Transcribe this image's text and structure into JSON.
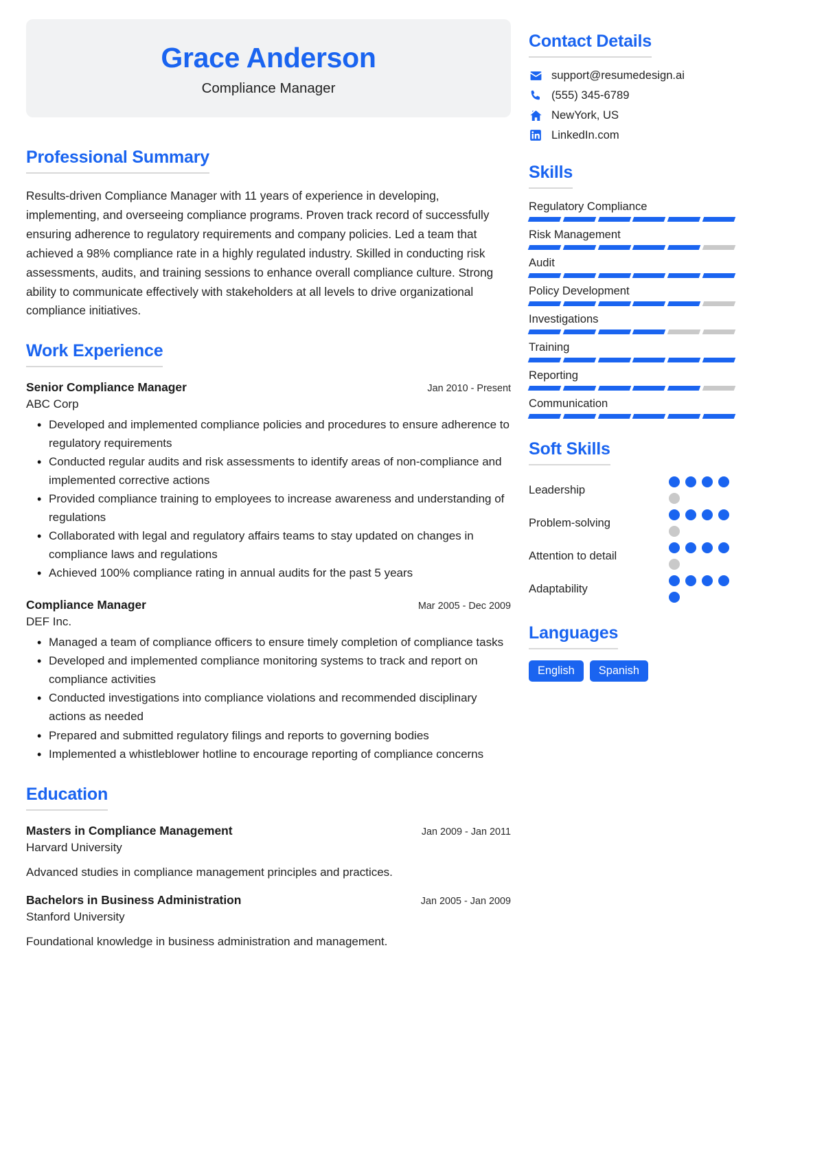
{
  "header": {
    "name": "Grace Anderson",
    "job_title": "Compliance Manager"
  },
  "summary": {
    "heading": "Professional Summary",
    "text": "Results-driven Compliance Manager with 11 years of experience in developing, implementing, and overseeing compliance programs. Proven track record of successfully ensuring adherence to regulatory requirements and company policies. Led a team that achieved a 98% compliance rate in a highly regulated industry. Skilled in conducting risk assessments, audits, and training sessions to enhance overall compliance culture. Strong ability to communicate effectively with stakeholders at all levels to drive organizational compliance initiatives."
  },
  "work_experience": {
    "heading": "Work Experience",
    "jobs": [
      {
        "title": "Senior Compliance Manager",
        "dates": "Jan 2010 - Present",
        "company": "ABC Corp",
        "bullets": [
          "Developed and implemented compliance policies and procedures to ensure adherence to regulatory requirements",
          "Conducted regular audits and risk assessments to identify areas of non-compliance and implemented corrective actions",
          "Provided compliance training to employees to increase awareness and understanding of regulations",
          "Collaborated with legal and regulatory affairs teams to stay updated on changes in compliance laws and regulations",
          "Achieved 100% compliance rating in annual audits for the past 5 years"
        ]
      },
      {
        "title": "Compliance Manager",
        "dates": "Mar 2005 - Dec 2009",
        "company": "DEF Inc.",
        "bullets": [
          "Managed a team of compliance officers to ensure timely completion of compliance tasks",
          "Developed and implemented compliance monitoring systems to track and report on compliance activities",
          "Conducted investigations into compliance violations and recommended disciplinary actions as needed",
          "Prepared and submitted regulatory filings and reports to governing bodies",
          "Implemented a whistleblower hotline to encourage reporting of compliance concerns"
        ]
      }
    ]
  },
  "education": {
    "heading": "Education",
    "entries": [
      {
        "degree": "Masters in Compliance Management",
        "dates": "Jan 2009 - Jan 2011",
        "school": "Harvard University",
        "description": "Advanced studies in compliance management principles and practices."
      },
      {
        "degree": "Bachelors in Business Administration",
        "dates": "Jan 2005 - Jan 2009",
        "school": "Stanford University",
        "description": "Foundational knowledge in business administration and management."
      }
    ]
  },
  "contact": {
    "heading": "Contact Details",
    "items": [
      {
        "icon": "email-icon",
        "value": "support@resumedesign.ai"
      },
      {
        "icon": "phone-icon",
        "value": "(555) 345-6789"
      },
      {
        "icon": "home-icon",
        "value": "NewYork, US"
      },
      {
        "icon": "linkedin-icon",
        "value": "LinkedIn.com"
      }
    ]
  },
  "skills": {
    "heading": "Skills",
    "segments_total": 6,
    "items": [
      {
        "name": "Regulatory Compliance",
        "filled": 6
      },
      {
        "name": "Risk Management",
        "filled": 5
      },
      {
        "name": "Audit",
        "filled": 6
      },
      {
        "name": "Policy Development",
        "filled": 5
      },
      {
        "name": "Investigations",
        "filled": 4
      },
      {
        "name": "Training",
        "filled": 6
      },
      {
        "name": "Reporting",
        "filled": 5
      },
      {
        "name": "Communication",
        "filled": 6
      }
    ]
  },
  "soft_skills": {
    "heading": "Soft Skills",
    "dots_total": 5,
    "items": [
      {
        "name": "Leadership",
        "filled": 4
      },
      {
        "name": "Problem-solving",
        "filled": 4
      },
      {
        "name": "Attention to detail",
        "filled": 4
      },
      {
        "name": "Adaptability",
        "filled": 5
      }
    ]
  },
  "languages": {
    "heading": "Languages",
    "items": [
      "English",
      "Spanish"
    ]
  },
  "colors": {
    "accent": "#1A64F0",
    "muted_bar": "#c9c9c9",
    "card_bg": "#f1f2f3",
    "rule": "#d8d8d8"
  }
}
